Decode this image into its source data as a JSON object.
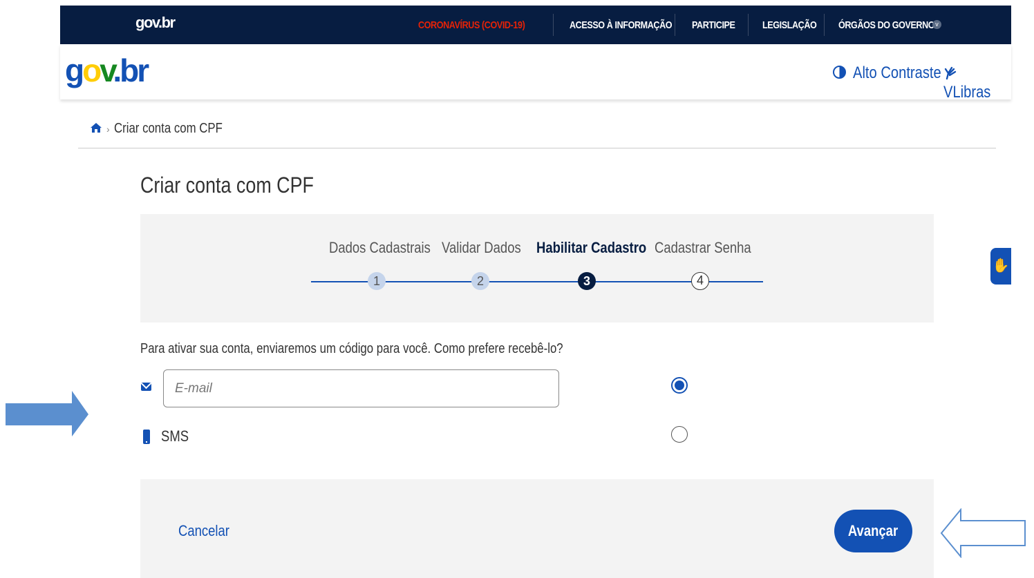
{
  "topbar": {
    "brand": "gov.br",
    "links": [
      "CORONAVÍRUS (COVID-19)",
      "ACESSO À INFORMAÇÃO",
      "PARTICIPE",
      "LEGISLAÇÃO",
      "ÓRGÃOS DO GOVERNO"
    ]
  },
  "header": {
    "logo": {
      "g": "g",
      "o": "o",
      "v": "v",
      "dot": ".",
      "br": "br"
    },
    "contrast_label": "Alto Contraste",
    "vlibras_label": "VLibras"
  },
  "breadcrumb": {
    "current": "Criar conta com CPF"
  },
  "page_title": "Criar conta com CPF",
  "stepper": {
    "steps": [
      {
        "label": "Dados Cadastrais",
        "number": "1",
        "state": "done"
      },
      {
        "label": "Validar Dados",
        "number": "2",
        "state": "done"
      },
      {
        "label": "Habilitar Cadastro",
        "number": "3",
        "state": "active"
      },
      {
        "label": "Cadastrar Senha",
        "number": "4",
        "state": "todo"
      }
    ]
  },
  "question": "Para ativar sua conta, enviaremos um código para você. Como prefere recebê-lo?",
  "options": {
    "email": {
      "placeholder": "E-mail",
      "value": "",
      "selected": true,
      "icon": "envelope-icon"
    },
    "sms": {
      "label": "SMS",
      "selected": false,
      "icon": "phone-icon"
    }
  },
  "actions": {
    "cancel_label": "Cancelar",
    "next_label": "Avançar"
  },
  "colors": {
    "primary": "#1351b4",
    "dark": "#071d41",
    "covid": "#e52207",
    "annotation_fill": "#5b8fcf"
  }
}
